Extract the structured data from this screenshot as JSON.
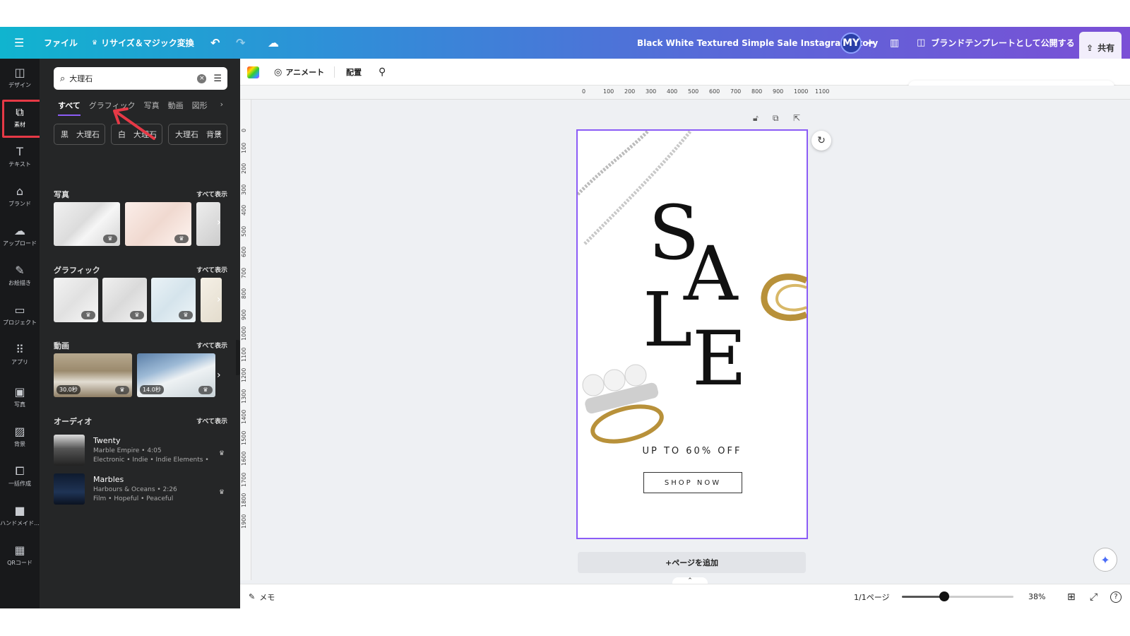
{
  "topbar": {
    "file": "ファイル",
    "resize": "リサイズ＆マジック変換",
    "doc_title": "Black White Textured Simple Sale Instagram Story",
    "avatar": "MY",
    "publish": "ブランドテンプレートとして公開する",
    "share": "共有"
  },
  "rail": [
    {
      "label": "デザイン",
      "icon": "◫"
    },
    {
      "label": "素材",
      "icon": "⧉"
    },
    {
      "label": "テキスト",
      "icon": "T"
    },
    {
      "label": "ブランド",
      "icon": "⌂"
    },
    {
      "label": "アップロード",
      "icon": "☁"
    },
    {
      "label": "お絵描き",
      "icon": "✎"
    },
    {
      "label": "プロジェクト",
      "icon": "▭"
    },
    {
      "label": "アプリ",
      "icon": "⠿"
    },
    {
      "label": "写真",
      "icon": "▣"
    },
    {
      "label": "背景",
      "icon": "▨"
    },
    {
      "label": "一括作成",
      "icon": "⧠"
    },
    {
      "label": "ハンドメイド...",
      "icon": "■"
    },
    {
      "label": "QRコード",
      "icon": "▦"
    }
  ],
  "panel": {
    "search_value": "大理石",
    "tabs": [
      "すべて",
      "グラフィック",
      "写真",
      "動画",
      "図形"
    ],
    "chips": [
      "黒　大理石",
      "白　大理石",
      "大理石　背景"
    ],
    "see_all": "すべて表示",
    "sections": {
      "photos": "写真",
      "graphics": "グラフィック",
      "videos": "動画",
      "audio": "オーディオ"
    },
    "videos": [
      "30.0秒",
      "14.0秒"
    ],
    "audio": [
      {
        "title": "Twenty",
        "artist": "Marble Empire • 4:05",
        "tags": "Electronic • Indie • Indie Elements •"
      },
      {
        "title": "Marbles",
        "artist": "Harbours & Oceans • 2:26",
        "tags": "Film • Hopeful • Peaceful"
      }
    ]
  },
  "toolbar": {
    "animate": "アニメート",
    "arrange": "配置"
  },
  "ruler": {
    "h": [
      "0",
      "100",
      "200",
      "300",
      "400",
      "500",
      "600",
      "700",
      "800",
      "900",
      "1000",
      "1100"
    ],
    "v": [
      "0",
      "100",
      "200",
      "300",
      "400",
      "500",
      "600",
      "700",
      "800",
      "900",
      "1000",
      "1100",
      "1200",
      "1300",
      "1400",
      "1500",
      "1600",
      "1700",
      "1800",
      "1900"
    ]
  },
  "design": {
    "letters": [
      "S",
      "A",
      "L",
      "E"
    ],
    "offer": "UP TO 60% OFF",
    "cta": "SHOP NOW"
  },
  "add_page": "+ページを追加",
  "status": {
    "notes": "メモ",
    "pages": "1/1ページ",
    "zoom_pct": 38,
    "zoom": "38%"
  },
  "colors": {
    "accent": "#8b5cf6",
    "highlight": "#e63946",
    "rail": "#18191b",
    "panel": "#252627"
  }
}
